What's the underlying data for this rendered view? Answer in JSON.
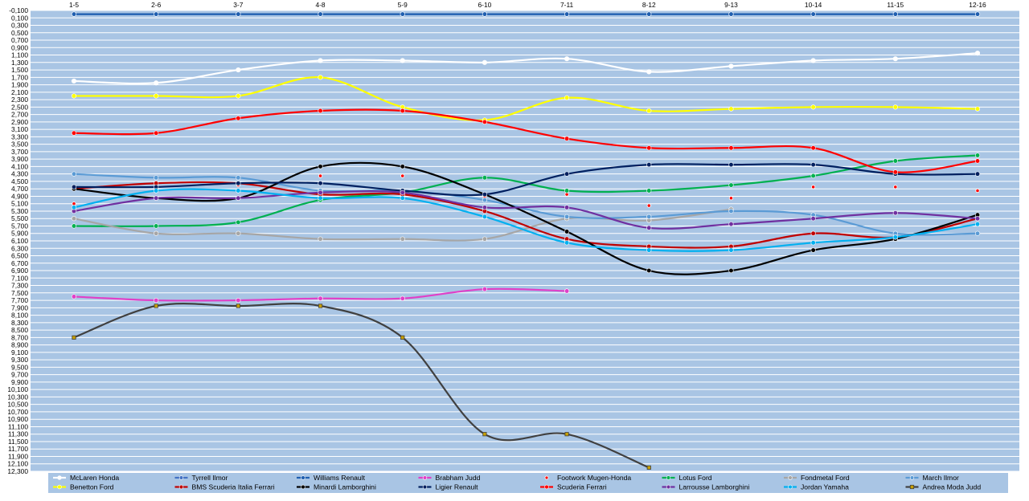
{
  "chart_data": {
    "type": "line",
    "categories": [
      "1-5",
      "2-6",
      "3-7",
      "4-8",
      "5-9",
      "6-10",
      "7-11",
      "8-12",
      "9-13",
      "10-14",
      "11-15",
      "12-16"
    ],
    "ylim": [
      -0.1,
      12.3
    ],
    "y_inverted": true,
    "y_tick_labels": [
      "-0,100",
      "0,100",
      "0,300",
      "0,500",
      "0,700",
      "0,900",
      "1,100",
      "1,300",
      "1,500",
      "1,700",
      "1,900",
      "2,100",
      "2,300",
      "2,500",
      "2,700",
      "2,900",
      "3,100",
      "3,300",
      "3,500",
      "3,700",
      "3,900",
      "4,100",
      "4,300",
      "4,500",
      "4,700",
      "4,900",
      "5,100",
      "5,300",
      "5,500",
      "5,700",
      "5,900",
      "6,100",
      "6,300",
      "6,500",
      "6,700",
      "6,900",
      "7,100",
      "7,300",
      "7,500",
      "7,700",
      "7,900",
      "8,100",
      "8,300",
      "8,500",
      "8,700",
      "8,900",
      "9,100",
      "9,300",
      "9,500",
      "9,700",
      "9,900",
      "10,100",
      "10,300",
      "10,500",
      "10,700",
      "10,900",
      "11,100",
      "11,300",
      "11,500",
      "11,700",
      "11,900",
      "12,100",
      "12,300"
    ],
    "grid": true,
    "plot_background": "#a9c5e4",
    "legend_position": "bottom",
    "series": [
      {
        "name": "McLaren Honda",
        "color": "#ffffff",
        "marker": "circle",
        "line": true,
        "values": [
          1.8,
          1.85,
          1.5,
          1.25,
          1.25,
          1.3,
          1.2,
          1.55,
          1.4,
          1.25,
          1.2,
          1.05
        ]
      },
      {
        "name": "Tyrrell Ilmor",
        "color": "#4472c4",
        "marker": "circle",
        "line": true,
        "values": [
          0,
          0,
          0,
          0,
          0,
          0,
          0,
          0,
          0,
          0,
          0,
          0
        ]
      },
      {
        "name": "Williams Renault",
        "color": "#1f5fb0",
        "marker": "circle",
        "line": true,
        "values": [
          0,
          0,
          0,
          0,
          0,
          0,
          0,
          0,
          0,
          0,
          0,
          0
        ]
      },
      {
        "name": "Brabham Judd",
        "color": "#e040c8",
        "marker": "circle",
        "line": true,
        "values": [
          7.6,
          7.7,
          7.7,
          7.65,
          7.65,
          7.4,
          7.45,
          null,
          null,
          null,
          null,
          null
        ]
      },
      {
        "name": "Footwork Mugen-Honda",
        "color": "#ff0000",
        "marker": "dot",
        "line": false,
        "values": [
          5.1,
          4.6,
          4.6,
          4.35,
          4.35,
          4.9,
          4.85,
          5.15,
          4.95,
          4.65,
          4.65,
          4.75
        ]
      },
      {
        "name": "Lotus Ford",
        "color": "#00b050",
        "marker": "circle",
        "line": true,
        "values": [
          5.7,
          5.7,
          5.6,
          5.0,
          4.8,
          4.4,
          4.75,
          4.75,
          4.6,
          4.35,
          3.95,
          3.8
        ]
      },
      {
        "name": "Fondmetal Ford",
        "color": "#a6a6a6",
        "marker": "circle",
        "line": true,
        "values": [
          5.5,
          5.9,
          5.9,
          6.05,
          6.05,
          6.05,
          5.5,
          5.55,
          5.25,
          null,
          null,
          null
        ]
      },
      {
        "name": "March Ilmor",
        "color": "#5b9bd5",
        "marker": "circle",
        "line": true,
        "values": [
          4.3,
          4.4,
          4.4,
          4.75,
          4.75,
          5.0,
          5.45,
          5.45,
          5.3,
          5.4,
          5.9,
          5.9
        ]
      },
      {
        "name": "Benetton Ford",
        "color": "#ffff00",
        "marker": "circle",
        "line": true,
        "values": [
          2.2,
          2.2,
          2.2,
          1.7,
          2.5,
          2.85,
          2.25,
          2.6,
          2.55,
          2.5,
          2.5,
          2.55
        ]
      },
      {
        "name": "BMS Scuderia Italia Ferrari",
        "color": "#c00000",
        "marker": "circle",
        "line": true,
        "values": [
          4.7,
          4.55,
          4.55,
          4.85,
          4.85,
          5.3,
          6.05,
          6.25,
          6.25,
          5.9,
          6.0,
          5.5
        ]
      },
      {
        "name": "Minardi Lamborghini",
        "color": "#000000",
        "marker": "circle",
        "line": true,
        "values": [
          4.7,
          4.95,
          4.95,
          4.1,
          4.1,
          4.85,
          5.85,
          6.9,
          6.9,
          6.35,
          6.05,
          5.4
        ]
      },
      {
        "name": "Ligier Renault",
        "color": "#002060",
        "marker": "circle",
        "line": true,
        "values": [
          4.65,
          4.65,
          4.55,
          4.55,
          4.75,
          4.85,
          4.3,
          4.05,
          4.05,
          4.05,
          4.3,
          4.3
        ]
      },
      {
        "name": "Scuderia Ferrari",
        "color": "#ff0000",
        "marker": "circle",
        "line": true,
        "values": [
          3.2,
          3.2,
          2.8,
          2.6,
          2.6,
          2.9,
          3.35,
          3.6,
          3.6,
          3.6,
          4.25,
          3.95
        ]
      },
      {
        "name": "Larrousse Lamborghini",
        "color": "#7030a0",
        "marker": "circle",
        "line": true,
        "values": [
          5.3,
          4.95,
          4.95,
          4.8,
          4.8,
          5.2,
          5.2,
          5.75,
          5.65,
          5.5,
          5.35,
          5.5
        ]
      },
      {
        "name": "Jordan Yamaha",
        "color": "#00b0f0",
        "marker": "circle",
        "line": true,
        "values": [
          5.2,
          4.75,
          4.75,
          4.95,
          4.95,
          5.45,
          6.15,
          6.35,
          6.35,
          6.15,
          6.0,
          5.65
        ]
      },
      {
        "name": "Andrea Moda Judd",
        "color": "#404040",
        "marker": "square",
        "marker_color": "#c8a000",
        "line": true,
        "values": [
          8.7,
          7.85,
          7.85,
          7.85,
          8.7,
          11.3,
          11.3,
          12.2,
          null,
          null,
          null,
          null
        ]
      }
    ]
  }
}
